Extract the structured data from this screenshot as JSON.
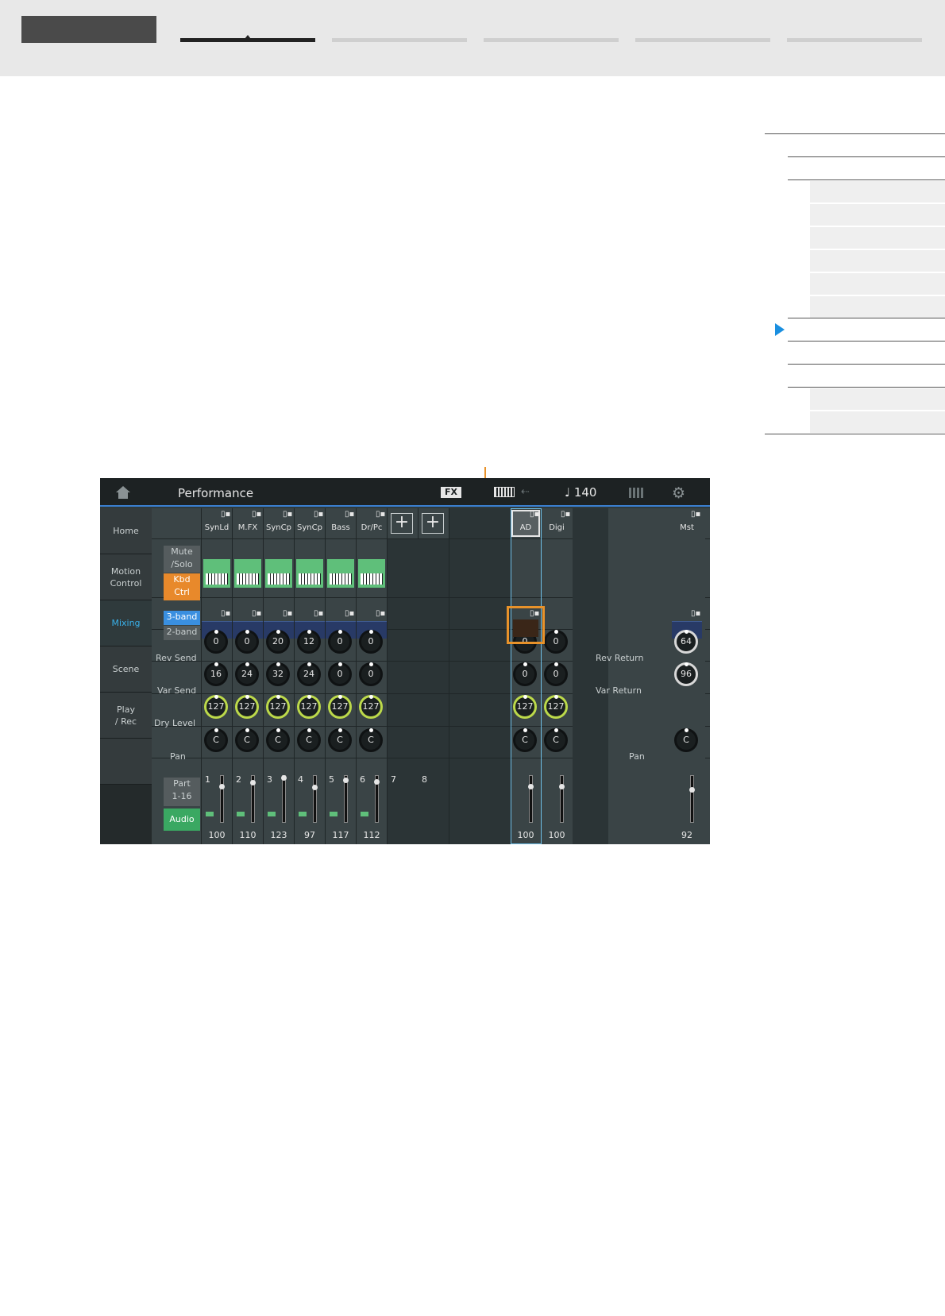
{
  "screen": {
    "title": "Performance",
    "fx_badge": "FX",
    "usb_symbol": "⇠",
    "tempo": "♩ 140",
    "nav": [
      {
        "label": "Home"
      },
      {
        "label": "Motion\nControl"
      },
      {
        "label": "Mixing"
      },
      {
        "label": "Scene"
      },
      {
        "label": "Play\n/ Rec"
      }
    ],
    "buttons": {
      "mute_solo": "Mute\n/Solo",
      "kbd_ctrl": "Kbd\nCtrl",
      "band3": "3-band",
      "band2": "2-band",
      "part": "Part\n1-16",
      "audio": "Audio"
    },
    "row_labels": {
      "rev_send": "Rev Send",
      "var_send": "Var Send",
      "dry_level": "Dry Level",
      "pan": "Pan",
      "rev_return": "Rev Return",
      "var_return": "Var Return",
      "pan_master": "Pan"
    },
    "parts": [
      {
        "num": "1",
        "name": "SynLd",
        "rev": "0",
        "var": "16",
        "dry": "127",
        "pan": "C",
        "level": "100",
        "fader": 0.79
      },
      {
        "num": "2",
        "name": "M.FX",
        "rev": "0",
        "var": "24",
        "dry": "127",
        "pan": "C",
        "level": "110",
        "fader": 0.87
      },
      {
        "num": "3",
        "name": "SynCp",
        "rev": "20",
        "var": "32",
        "dry": "127",
        "pan": "C",
        "level": "123",
        "fader": 0.97
      },
      {
        "num": "4",
        "name": "SynCp",
        "rev": "12",
        "var": "24",
        "dry": "127",
        "pan": "C",
        "level": "97",
        "fader": 0.76
      },
      {
        "num": "5",
        "name": "Bass",
        "rev": "0",
        "var": "0",
        "dry": "127",
        "pan": "C",
        "level": "117",
        "fader": 0.92
      },
      {
        "num": "6",
        "name": "Dr/Pc",
        "rev": "0",
        "var": "0",
        "dry": "127",
        "pan": "C",
        "level": "112",
        "fader": 0.88
      }
    ],
    "empty_parts": [
      "7",
      "8"
    ],
    "audio_parts": [
      {
        "name": "AD",
        "rev": "0",
        "var": "0",
        "dry": "127",
        "pan": "C",
        "level": "100",
        "fader": 0.79
      },
      {
        "name": "Digi",
        "rev": "0",
        "var": "0",
        "dry": "127",
        "pan": "C",
        "level": "100",
        "fader": 0.79
      }
    ],
    "master": {
      "name": "Mst",
      "rev_return": "64",
      "var_return": "96",
      "pan": "C",
      "level": "92",
      "fader": 0.72
    }
  }
}
